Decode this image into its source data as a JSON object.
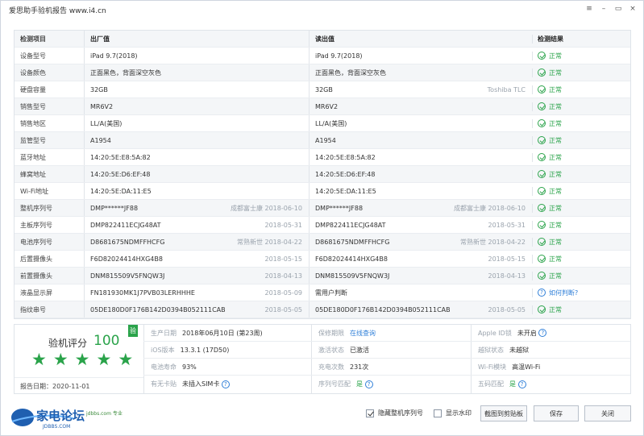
{
  "window": {
    "title": "爱思助手验机报告 www.i4.cn",
    "controls": [
      "≡",
      "–",
      "▭",
      "×"
    ]
  },
  "table": {
    "headers": [
      "检测项目",
      "出厂值",
      "读出值",
      "检测结果"
    ],
    "rows": [
      {
        "item": "设备型号",
        "factory": "iPad 9.7(2018)",
        "factory_meta": "",
        "read": "iPad 9.7(2018)",
        "read_meta": "",
        "result": "正常",
        "status": "ok"
      },
      {
        "item": "设备颜色",
        "factory": "正面黑色，背面深空灰色",
        "factory_meta": "",
        "read": "正面黑色，背面深空灰色",
        "read_meta": "",
        "result": "正常",
        "status": "ok"
      },
      {
        "item": "硬盘容量",
        "factory": "32GB",
        "factory_meta": "",
        "read": "32GB",
        "read_meta": "Toshiba TLC",
        "result": "正常",
        "status": "ok"
      },
      {
        "item": "销售型号",
        "factory": "MR6V2",
        "factory_meta": "",
        "read": "MR6V2",
        "read_meta": "",
        "result": "正常",
        "status": "ok"
      },
      {
        "item": "销售地区",
        "factory": "LL/A(美国)",
        "factory_meta": "",
        "read": "LL/A(美国)",
        "read_meta": "",
        "result": "正常",
        "status": "ok"
      },
      {
        "item": "监管型号",
        "factory": "A1954",
        "factory_meta": "",
        "read": "A1954",
        "read_meta": "",
        "result": "正常",
        "status": "ok"
      },
      {
        "item": "蓝牙地址",
        "factory": "14:20:5E:E8:5A:82",
        "factory_meta": "",
        "read": "14:20:5E:E8:5A:82",
        "read_meta": "",
        "result": "正常",
        "status": "ok"
      },
      {
        "item": "蜂窝地址",
        "factory": "14:20:5E:D6:EF:48",
        "factory_meta": "",
        "read": "14:20:5E:D6:EF:48",
        "read_meta": "",
        "result": "正常",
        "status": "ok"
      },
      {
        "item": "Wi-Fi地址",
        "factory": "14:20:5E:DA:11:E5",
        "factory_meta": "",
        "read": "14:20:5E:DA:11:E5",
        "read_meta": "",
        "result": "正常",
        "status": "ok"
      },
      {
        "item": "整机序列号",
        "factory": "DMP******JF88",
        "factory_meta": "成都富士康  2018-06-10",
        "read": "DMP******JF88",
        "read_meta": "成都富士康  2018-06-10",
        "result": "正常",
        "status": "ok"
      },
      {
        "item": "主板序列号",
        "factory": "DMP822411ECJG48AT",
        "factory_meta": "2018-05-31",
        "read": "DMP822411ECJG48AT",
        "read_meta": "2018-05-31",
        "result": "正常",
        "status": "ok"
      },
      {
        "item": "电池序列号",
        "factory": "D8681675NDMFFHCFG",
        "factory_meta": "常熟新世  2018-04-22",
        "read": "D8681675NDMFFHCFG",
        "read_meta": "常熟新世  2018-04-22",
        "result": "正常",
        "status": "ok"
      },
      {
        "item": "后置摄像头",
        "factory": "F6D82024414HXG4B8",
        "factory_meta": "2018-05-15",
        "read": "F6D82024414HXG4B8",
        "read_meta": "2018-05-15",
        "result": "正常",
        "status": "ok"
      },
      {
        "item": "前置摄像头",
        "factory": "DNM815509V5FNQW3J",
        "factory_meta": "2018-04-13",
        "read": "DNM815509V5FNQW3J",
        "read_meta": "2018-04-13",
        "result": "正常",
        "status": "ok"
      },
      {
        "item": "液晶显示屏",
        "factory": "FN181930MK1J7PVB03LERHHHE",
        "factory_meta": "2018-05-09",
        "read": "需用户判断",
        "read_meta": "",
        "result": "如何判断?",
        "status": "help"
      },
      {
        "item": "指纹串号",
        "factory": "05DE180D0F176B142D0394B052111CAB",
        "factory_meta": "2018-05-05",
        "read": "05DE180D0F176B142D0394B052111CAB",
        "read_meta": "2018-05-05",
        "result": "正常",
        "status": "ok"
      }
    ]
  },
  "summary": {
    "score_label": "验机评分",
    "score": "100",
    "badge": "验",
    "stars": 5,
    "report_date": "报告日期：2020-11-01",
    "cells": {
      "mfg_date_label": "生产日期",
      "mfg_date": "2018年06月10日 (第23周)",
      "warranty_label": "保修期限",
      "warranty": "在线查询",
      "appleid_label": "Apple ID锁",
      "appleid": "未开启",
      "ios_label": "iOS版本",
      "ios": "13.3.1 (17D50)",
      "activation_label": "激活状态",
      "activation": "已激活",
      "jailbreak_label": "越狱状态",
      "jailbreak": "未越狱",
      "battery_label": "电池寿命",
      "battery": "93%",
      "charge_label": "充电次数",
      "charge": "231次",
      "wifi_label": "Wi-Fi模块",
      "wifi": "高温Wi-Fi",
      "sim_label": "有无卡贴",
      "sim": "未插入SIM卡",
      "serial_match_label": "序列号匹配",
      "serial_match": "是",
      "five_code_label": "五码匹配",
      "five_code": "是"
    }
  },
  "footer": {
    "logo_text": "家电论坛",
    "logo_sub": "JDBBS.COM",
    "logo_tag": "jdbbs.com 专业",
    "hide_serial_label": "隐藏整机序列号",
    "hide_serial_checked": true,
    "watermark_label": "显示水印",
    "watermark_checked": false,
    "screenshot_btn": "截图到剪贴板",
    "save_btn": "保存",
    "close_btn": "关闭"
  },
  "colors": {
    "accent_green": "#2aa34a",
    "link_blue": "#2f7fd8"
  }
}
